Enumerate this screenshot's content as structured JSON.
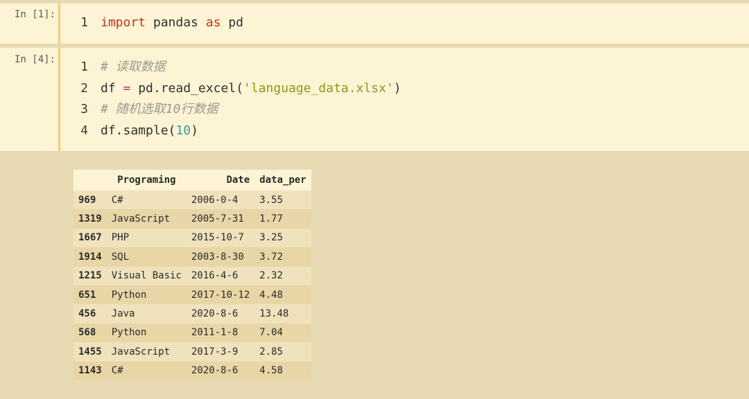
{
  "cells": [
    {
      "prompt": "In [1]:",
      "lines": [
        {
          "no": "1",
          "tokens": [
            {
              "t": "import",
              "k": "kw"
            },
            {
              "t": " pandas ",
              "k": ""
            },
            {
              "t": "as",
              "k": "kw"
            },
            {
              "t": " pd",
              "k": ""
            }
          ]
        }
      ]
    },
    {
      "prompt": "In [4]:",
      "lines": [
        {
          "no": "1",
          "tokens": [
            {
              "t": "# 读取数据",
              "k": "cm"
            }
          ]
        },
        {
          "no": "2",
          "tokens": [
            {
              "t": "df ",
              "k": ""
            },
            {
              "t": "=",
              "k": "op"
            },
            {
              "t": " pd.read_excel(",
              "k": ""
            },
            {
              "t": "'language_data.xlsx'",
              "k": "str"
            },
            {
              "t": ")",
              "k": ""
            }
          ]
        },
        {
          "no": "3",
          "tokens": [
            {
              "t": "# 随机选取10行数据",
              "k": "cm"
            }
          ]
        },
        {
          "no": "4",
          "tokens": [
            {
              "t": "df.sample(",
              "k": ""
            },
            {
              "t": "10",
              "k": "num"
            },
            {
              "t": ")",
              "k": ""
            }
          ]
        }
      ]
    }
  ],
  "output_table": {
    "columns": [
      "",
      "Programing",
      "Date",
      "data_per"
    ],
    "rows": [
      {
        "index": "969",
        "Programing": "C#",
        "Date": "2006-0-4",
        "data_per": "3.55"
      },
      {
        "index": "1319",
        "Programing": "JavaScript",
        "Date": "2005-7-31",
        "data_per": "1.77"
      },
      {
        "index": "1667",
        "Programing": "PHP",
        "Date": "2015-10-7",
        "data_per": "3.25"
      },
      {
        "index": "1914",
        "Programing": "SQL",
        "Date": "2003-8-30",
        "data_per": "3.72"
      },
      {
        "index": "1215",
        "Programing": "Visual Basic",
        "Date": "2016-4-6",
        "data_per": "2.32"
      },
      {
        "index": "651",
        "Programing": "Python",
        "Date": "2017-10-12",
        "data_per": "4.48"
      },
      {
        "index": "456",
        "Programing": "Java",
        "Date": "2020-8-6",
        "data_per": "13.48"
      },
      {
        "index": "568",
        "Programing": "Python",
        "Date": "2011-1-8",
        "data_per": "7.04"
      },
      {
        "index": "1455",
        "Programing": "JavaScript",
        "Date": "2017-3-9",
        "data_per": "2.85"
      },
      {
        "index": "1143",
        "Programing": "C#",
        "Date": "2020-8-6",
        "data_per": "4.58"
      }
    ]
  },
  "colors": {
    "background": "#e8dab2",
    "cell_background": "#fcf4d4",
    "cell_bar": "#f2c97c",
    "keyword": "#c2331d",
    "operator": "#b0307a",
    "string": "#8a9a17",
    "number": "#3b9ca0",
    "comment": "#9a9a90"
  }
}
